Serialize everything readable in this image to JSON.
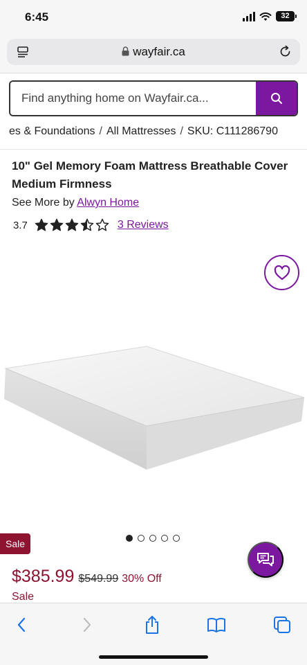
{
  "status_bar": {
    "time": "6:45",
    "battery": "32"
  },
  "browser": {
    "url": "wayfair.ca"
  },
  "search": {
    "placeholder": "Find anything home on Wayfair.ca..."
  },
  "breadcrumb": [
    "es & Foundations",
    "All Mattresses",
    "SKU: C111286790"
  ],
  "product": {
    "title": "10\" Gel Memory Foam Mattress Breathable Cover Medium Firmness",
    "see_more_prefix": "See More by",
    "brand": "Alwyn Home",
    "rating": "3.7",
    "rating_value": 3.5,
    "reviews": "3 Reviews"
  },
  "gallery": {
    "image_count": 5,
    "active_index": 0
  },
  "badges": {
    "sale_badge": "Sale"
  },
  "pricing": {
    "current": "$385.99",
    "original": "$549.99",
    "discount": "30% Off",
    "sale_label": "Sale"
  },
  "colors": {
    "brand_purple": "#7b189f",
    "sale_red": "#8e1331"
  },
  "icons": [
    "menu-icon",
    "lock-icon",
    "reload-icon",
    "search-icon",
    "star-icon",
    "heart-icon",
    "chat-icon",
    "back-icon",
    "forward-icon",
    "share-icon",
    "bookmarks-icon",
    "tabs-icon"
  ]
}
